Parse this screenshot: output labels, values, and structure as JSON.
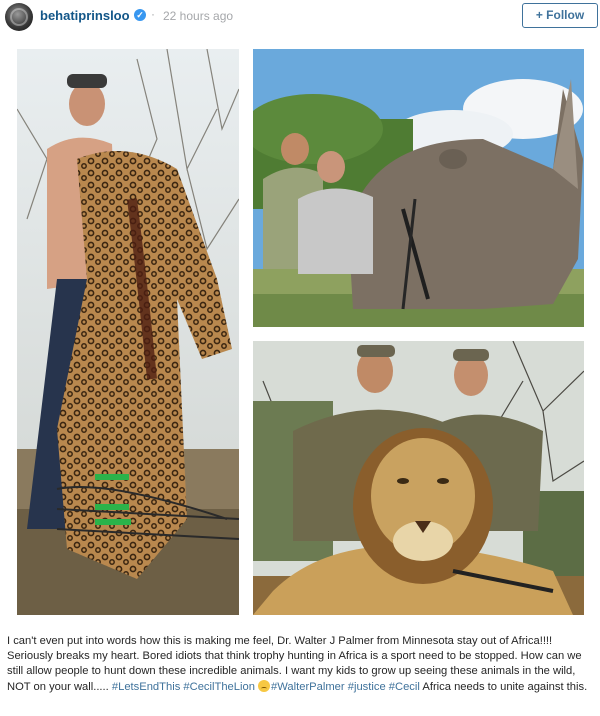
{
  "post": {
    "username": "behatiprinsloo",
    "separator": "·",
    "timestamp": "22 hours ago",
    "follow_label": "+ Follow"
  },
  "icons": {
    "avatar": "avatar-photo",
    "verified": "verified-badge-icon",
    "emoji": "crying-face-emoji"
  },
  "colors": {
    "username": "#125688",
    "hashtag": "#3f729b",
    "verified": "#3897f0",
    "follow_border": "#3f729b",
    "timestamp": "#a5a7aa"
  },
  "caption": {
    "text_before_tags": "I can't even put into words how this is making me feel, Dr. Walter J Palmer from Minnesota stay out of Africa!!!! Seriously breaks my heart. Bored idiots that think trophy hunting in Africa is a sport need to be stopped. How can we still allow people to hunt down these incredible animals. I want my kids to grow up seeing these animals in the wild, NOT on your wall.....",
    "tag_lets_end_this": "#LetsEndThis",
    "tag_cecil_the_lion": "#CecilTheLion",
    "tag_walter_palmer": "#WalterPalmer",
    "tag_justice": "#justice",
    "tag_cecil": "#Cecil",
    "text_after_tags": "Africa needs to unite against this."
  },
  "photos": [
    {
      "subject": "leopard-trophy-photo"
    },
    {
      "subject": "rhino-trophy-photo"
    },
    {
      "subject": "lion-trophy-photo"
    }
  ]
}
